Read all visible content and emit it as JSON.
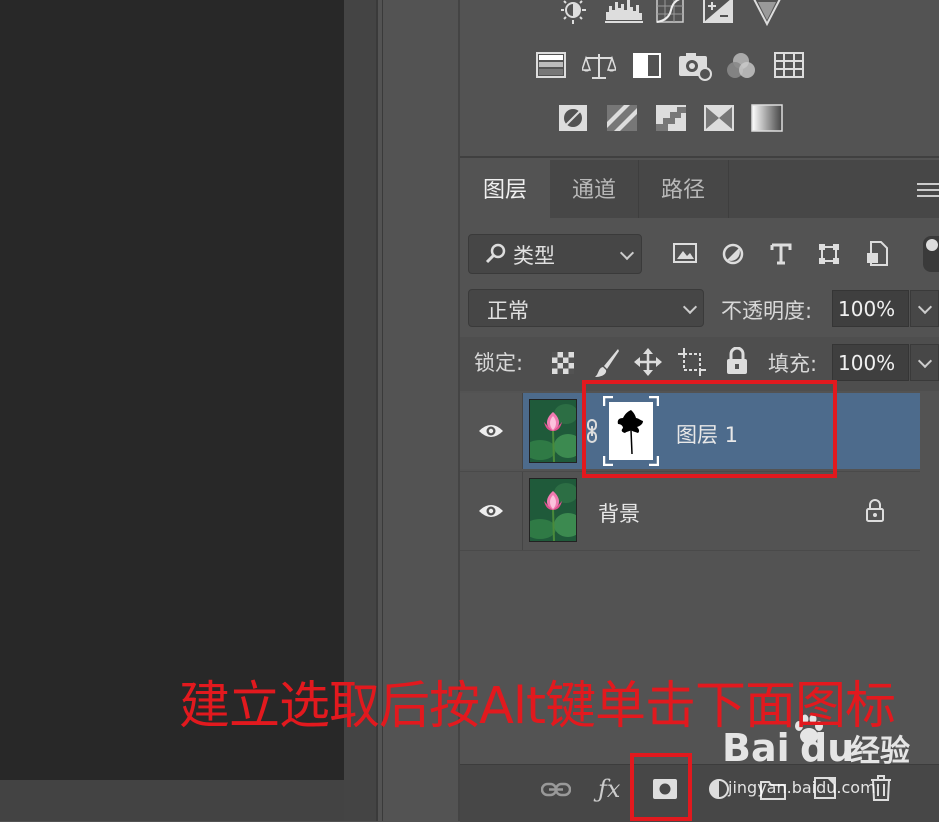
{
  "tabs": [
    {
      "label": "图层",
      "active": true
    },
    {
      "label": "通道",
      "active": false
    },
    {
      "label": "路径",
      "active": false
    }
  ],
  "filter": {
    "label": "类型"
  },
  "blend_mode": {
    "label": "正常"
  },
  "opacity": {
    "label": "不透明度:",
    "value": "100%"
  },
  "lock": {
    "label": "锁定:"
  },
  "fill": {
    "label": "填充:",
    "value": "100%"
  },
  "layers": [
    {
      "name": "图层 1",
      "selected": true,
      "has_mask": true
    },
    {
      "name": "背景",
      "selected": false,
      "locked": true
    }
  ],
  "annotation": {
    "text": "建立选取后按Alt键单击下面图标"
  },
  "watermark": {
    "brand_a": "Bai",
    "brand_b": "du",
    "brand_cn": "经验",
    "url": "jingyan.baidu.com"
  },
  "colors": {
    "annotation_red": "#e2191e",
    "selection_blue": "#4d6b8c",
    "panel_bg": "#535353"
  },
  "icons": [
    "brightness-icon",
    "levels-icon",
    "curves-icon",
    "exposure-icon",
    "vibrance-icon",
    "hue-saturation-icon",
    "color-balance-icon",
    "black-white-icon",
    "photo-filter-icon",
    "channel-mixer-icon",
    "color-lookup-icon",
    "invert-icon",
    "posterize-icon",
    "threshold-icon",
    "selective-color-icon",
    "gradient-map-icon",
    "link-layers-icon",
    "fx-icon",
    "add-mask-icon",
    "adjustment-layer-icon",
    "new-group-icon",
    "new-layer-icon",
    "delete-icon"
  ]
}
